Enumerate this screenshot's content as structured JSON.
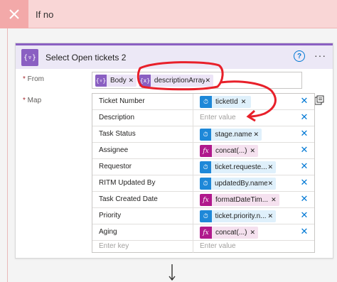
{
  "branch": {
    "title": "If no"
  },
  "action": {
    "title": "Select Open tickets 2",
    "from_label": "From",
    "map_label": "Map",
    "from_tokens": [
      {
        "label": "Body",
        "kind": "variable",
        "icon": "variable-icon"
      },
      {
        "label": "descriptionArray",
        "kind": "variable",
        "icon": "variable-icon"
      }
    ]
  },
  "map": {
    "rows": [
      {
        "key": "Ticket Number",
        "value": "ticketId",
        "kind": "dynamic"
      },
      {
        "key": "Description",
        "value": "",
        "placeholder": "Enter value"
      },
      {
        "key": "Task Status",
        "value": "stage.name",
        "kind": "dynamic"
      },
      {
        "key": "Assignee",
        "value": "concat(...)",
        "kind": "expression"
      },
      {
        "key": "Requestor",
        "value": "ticket.requeste...",
        "kind": "dynamic"
      },
      {
        "key": "RITM Updated By",
        "value": "updatedBy.name",
        "kind": "dynamic"
      },
      {
        "key": "Task Created Date",
        "value": "formatDateTim...",
        "kind": "expression"
      },
      {
        "key": "Priority",
        "value": "ticket.priority.n...",
        "kind": "dynamic"
      },
      {
        "key": "Aging",
        "value": "concat(...)",
        "kind": "expression"
      }
    ],
    "new_row": {
      "key_placeholder": "Enter key",
      "value_placeholder": "Enter value"
    }
  },
  "colors": {
    "branch_band": "#f9d6d6",
    "action_accent": "#8a5fc2",
    "dynamic_token": "#1e88d8",
    "expression_token": "#b0198c",
    "annotation": "#e8202a"
  }
}
